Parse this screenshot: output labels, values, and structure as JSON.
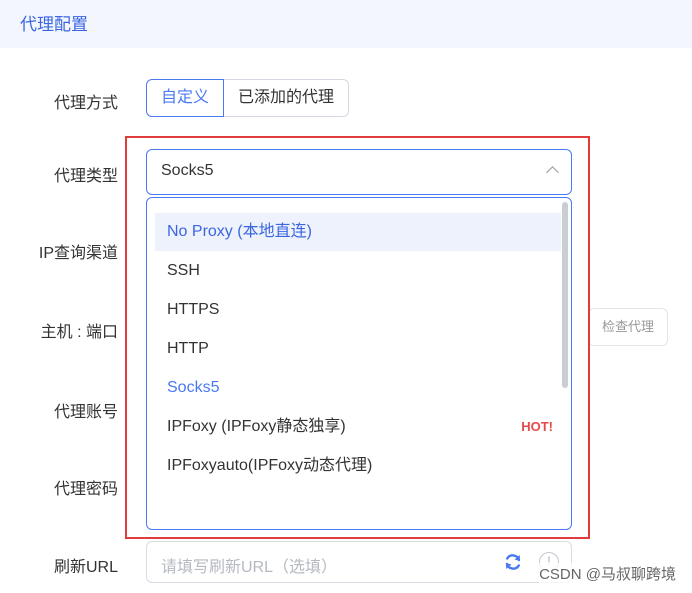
{
  "header": {
    "title": "代理配置"
  },
  "labels": {
    "proxy_mode": "代理方式",
    "proxy_type": "代理类型",
    "ip_channel": "IP查询渠道",
    "host_port": "主机 : 端口",
    "proxy_account": "代理账号",
    "proxy_password": "代理密码",
    "refresh_url": "刷新URL"
  },
  "proxy_mode": {
    "options": [
      "自定义",
      "已添加的代理"
    ],
    "active": "自定义"
  },
  "proxy_type": {
    "value": "Socks5",
    "options": [
      "No Proxy (本地直连)",
      "SSH",
      "HTTPS",
      "HTTP",
      "Socks5",
      "IPFoxy (IPFoxy静态独享)",
      "IPFoxyauto(IPFoxy动态代理)"
    ],
    "hover": "No Proxy (本地直连)",
    "hot_badge": "HOT!"
  },
  "check_proxy_button": "检查代理",
  "refresh_url_input": {
    "placeholder": "请填写刷新URL（选填）"
  },
  "watermark": "CSDN @马叔聊跨境",
  "colors": {
    "accent": "#4a7af2",
    "highlight_frame": "#e03c3c",
    "hot": "#e64a4a"
  },
  "icons": {
    "refresh": "refresh-icon",
    "info": "info-icon",
    "dropdown": "chevron-up-icon"
  }
}
